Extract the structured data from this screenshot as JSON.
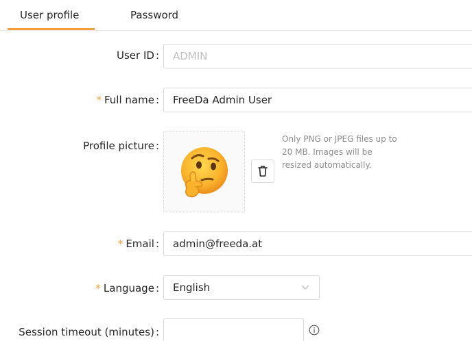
{
  "tabs": [
    {
      "label": "User profile",
      "active": true
    },
    {
      "label": "Password",
      "active": false
    }
  ],
  "form": {
    "required_mark": "*",
    "colon": ":",
    "user_id": {
      "label": "User ID",
      "value": "ADMIN"
    },
    "full_name": {
      "label": "Full name",
      "value": "FreeDa Admin User",
      "required": true
    },
    "profile_picture": {
      "label": "Profile picture",
      "hint": "Only PNG or JPEG files up to 20 MB. Images will be resized automatically.",
      "image": "thinking-face-emoji",
      "delete_icon": "trash-icon"
    },
    "email": {
      "label": "Email",
      "value": "admin@freeda.at",
      "required": true
    },
    "language": {
      "label": "Language",
      "value": "English",
      "required": true,
      "icon": "chevron-down-icon"
    },
    "session_timeout": {
      "label": "Session timeout (minutes)",
      "value": "",
      "icon": "info-icon"
    }
  },
  "colors": {
    "accent": "#f5a03a",
    "border": "#d9d9d9",
    "disabled_text": "#bfbfbf",
    "hint_text": "#8c8c8c"
  }
}
